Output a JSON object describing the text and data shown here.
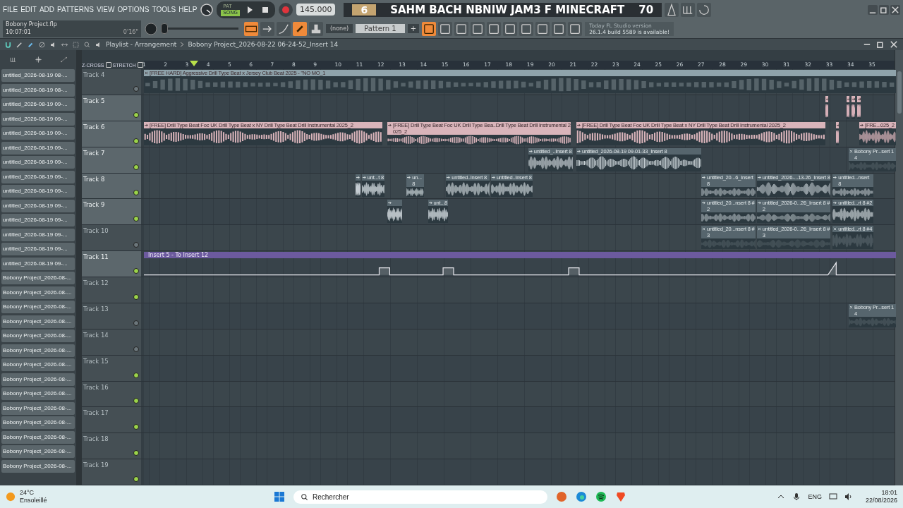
{
  "menu": [
    "FILE",
    "EDIT",
    "ADD",
    "PATTERNS",
    "VIEW",
    "OPTIONS",
    "TOOLS",
    "HELP"
  ],
  "project": {
    "file": "Bobony Project.flp",
    "time": "10:07:01",
    "length": "0'16\""
  },
  "master": {
    "level": 0
  },
  "mode": [
    {
      "label": "PAT",
      "selected": false
    },
    {
      "label": "SONG",
      "selected": true
    }
  ],
  "tempo": "145.000",
  "overlay": {
    "badge": "6",
    "title": "SAHM BACH NBNIW JAM3 F MINECRAFT",
    "count": "70"
  },
  "pattern": {
    "channel": "(none)",
    "name": "Pattern 1",
    "add": "+"
  },
  "hint": {
    "line_1": "Today  FL Studio version",
    "line_2": "26.1.4 build 5589 is available!"
  },
  "playlist": {
    "title": "Playlist - Arrangement",
    "path": "Bobony Project_2026-08-22 06-24-52_Insert 14",
    "z_cross": {
      "label": "Z-CROSS",
      "checked": false
    },
    "stretch": {
      "label": "STRETCH",
      "checked": false
    }
  },
  "browser": [
    "untitled_2026-08-19 08-...",
    "untitled_2026-08-19 08-...",
    "untitled_2026-08-19 09-...",
    "untitled_2026-08-19 09-...",
    "untitled_2026-08-19 09-...",
    "untitled_2026-08-19 09-...",
    "untitled_2026-08-19 09-...",
    "untitled_2026-08-19 09-...",
    "untitled_2026-08-19 09-...",
    "untitled_2026-08-19 09-...",
    "untitled_2026-08-19 09-...",
    "untitled_2026-08-19 09-...",
    "untitled_2026-08-19 09-...",
    "untitled_2026-08-19 09-...",
    "Bobony Project_2026-08-...",
    "Bobony Project_2026-08-...",
    "Bobony Project_2026-08-...",
    "Bobony Project_2026-08-...",
    "Bobony Project_2026-08-...",
    "Bobony Project_2026-08-...",
    "Bobony Project_2026-08-...",
    "Bobony Project_2026-08-...",
    "Bobony Project_2026-08-...",
    "Bobony Project_2026-08-...",
    "Bobony Project_2026-08-...",
    "Bobony Project_2026-08-...",
    "Bobony Project_2026-08-...",
    "Bobony Project_2026-08-..."
  ],
  "ruler": [
    "1",
    "2",
    "3",
    "4",
    "5",
    "6",
    "7",
    "8",
    "9",
    "10",
    "11",
    "12",
    "13",
    "14",
    "15",
    "16",
    "17",
    "18",
    "19",
    "20",
    "21",
    "22",
    "23",
    "24",
    "25",
    "26",
    "27",
    "28",
    "29",
    "30",
    "31",
    "32",
    "33",
    "34",
    "35"
  ],
  "tracks": [
    {
      "name": "Track 4",
      "faded": true,
      "enabled": false,
      "clips": [
        {
          "kind": "audio",
          "label": "[FREE HARD] Aggressive Drill Type Beat x Jersey Club Beat 2025 - \"NO MO_1",
          "muted": true,
          "color": "#8fa3ab"
        }
      ]
    },
    {
      "name": "Track 5",
      "faded": false,
      "enabled": true,
      "clips": [
        {
          "kind": "audio",
          "muted": false,
          "color": "#d9b4ba"
        },
        {
          "kind": "audio",
          "muted": false,
          "color": "#d9b4ba"
        },
        {
          "kind": "audio",
          "muted": false,
          "color": "#d9b4ba"
        },
        {
          "kind": "audio",
          "muted": false,
          "color": "#d9b4ba"
        }
      ]
    },
    {
      "name": "Track 6",
      "faded": false,
      "enabled": true,
      "clips": [
        {
          "kind": "audio",
          "label": "[FREE] Drill Type Beat Foc  UK Drill Type Beat x NY Drill Type Beat  Drill Instrumental 2025_2",
          "muted": false,
          "color": "#d9b4ba"
        },
        {
          "kind": "audio",
          "label": "[FREE] Drill Type Beat Foc  UK Drill Type Bea..Drill Type Beat  Drill Instrumental 2025_2",
          "muted": false,
          "color": "#d9b4ba"
        },
        {
          "kind": "audio",
          "label": "[FREE] Drill Type Beat Foc  UK Drill Type Beat x NY Drill Type Beat  Drill Instrumental 2025_2",
          "muted": false,
          "color": "#d9b4ba"
        },
        {
          "kind": "audio",
          "muted": false,
          "color": "#d9b4ba"
        },
        {
          "kind": "audio",
          "label": "[FRE...025_2",
          "muted": false,
          "color": "#d9b4ba"
        }
      ]
    },
    {
      "name": "Track 7",
      "faded": false,
      "enabled": true,
      "clips": [
        {
          "kind": "audio",
          "label": "untitled_..Insert 8",
          "muted": false,
          "color": "#56656d"
        },
        {
          "kind": "audio",
          "label": "untitled_2026-08-19 09-01-33_Insert 8",
          "muted": false,
          "color": "#56656d"
        },
        {
          "kind": "audio",
          "label": "Bobony Pr...sert 14",
          "muted": true,
          "color": "#56656d"
        }
      ]
    },
    {
      "name": "Track 8",
      "faded": false,
      "enabled": true,
      "clips": [
        {
          "kind": "audio",
          "muted": false,
          "color": "#56656d"
        },
        {
          "kind": "audio",
          "label": "unt...t 8",
          "muted": false,
          "color": "#56656d"
        },
        {
          "kind": "audio",
          "label": "un...8",
          "muted": false,
          "color": "#56656d"
        },
        {
          "kind": "audio",
          "label": "untitled..Insert 8",
          "muted": false,
          "color": "#56656d"
        },
        {
          "kind": "audio",
          "label": "untitled..Insert 8",
          "muted": false,
          "color": "#56656d"
        },
        {
          "kind": "audio",
          "label": "untitled_20...6_Insert 8",
          "muted": false,
          "color": "#56656d"
        },
        {
          "kind": "audio",
          "label": "untitled_2026-...13-26_Insert 8",
          "muted": false,
          "color": "#56656d"
        },
        {
          "kind": "audio",
          "label": "untitled...nsert 8",
          "muted": false,
          "color": "#56656d"
        }
      ]
    },
    {
      "name": "Track 9",
      "faded": false,
      "enabled": true,
      "clips": [
        {
          "kind": "audio",
          "muted": false,
          "color": "#56656d"
        },
        {
          "kind": "audio",
          "label": "unt...8",
          "muted": false,
          "color": "#56656d"
        },
        {
          "kind": "audio",
          "label": "untitled_20...nsert 8 #2",
          "muted": false,
          "color": "#56656d"
        },
        {
          "kind": "audio",
          "label": "untitled_2026-0...26_Insert 8 #2",
          "muted": false,
          "color": "#56656d"
        },
        {
          "kind": "audio",
          "label": "untitled...rt 8 #2",
          "muted": false,
          "color": "#56656d"
        }
      ]
    },
    {
      "name": "Track 10",
      "faded": true,
      "enabled": false,
      "clips": [
        {
          "kind": "audio",
          "label": "untitled_20...nsert 8 #3",
          "muted": true,
          "color": "#56656d"
        },
        {
          "kind": "audio",
          "label": "untitled_2026-0...26_Insert 8 #3",
          "muted": true,
          "color": "#56656d"
        },
        {
          "kind": "audio",
          "label": "untitled...rt 8 #4",
          "muted": true,
          "color": "#56656d"
        }
      ]
    },
    {
      "name": "Track 11",
      "faded": false,
      "enabled": true,
      "clips": [
        {
          "kind": "automation",
          "label": "Insert 5 - To Insert 12",
          "color": "#6c5a9e"
        }
      ]
    },
    {
      "name": "Track 12",
      "faded": true,
      "enabled": true
    },
    {
      "name": "Track 13",
      "faded": true,
      "enabled": false,
      "clips": [
        {
          "kind": "audio",
          "label": "Bobony Pr...sert 14",
          "muted": true,
          "color": "#56656d"
        }
      ]
    },
    {
      "name": "Track 14",
      "faded": true,
      "enabled": false
    },
    {
      "name": "Track 15",
      "faded": true,
      "enabled": true
    },
    {
      "name": "Track 16",
      "faded": true,
      "enabled": true
    },
    {
      "name": "Track 17",
      "faded": true,
      "enabled": true
    },
    {
      "name": "Track 18",
      "faded": true,
      "enabled": true
    },
    {
      "name": "Track 19",
      "faded": true,
      "enabled": true
    }
  ],
  "taskbar": {
    "temperature": "24°C",
    "weather": "Ensoleillé",
    "search": "Rechercher",
    "language": "ENG",
    "time": "18:01",
    "date": "22/08/2026"
  }
}
